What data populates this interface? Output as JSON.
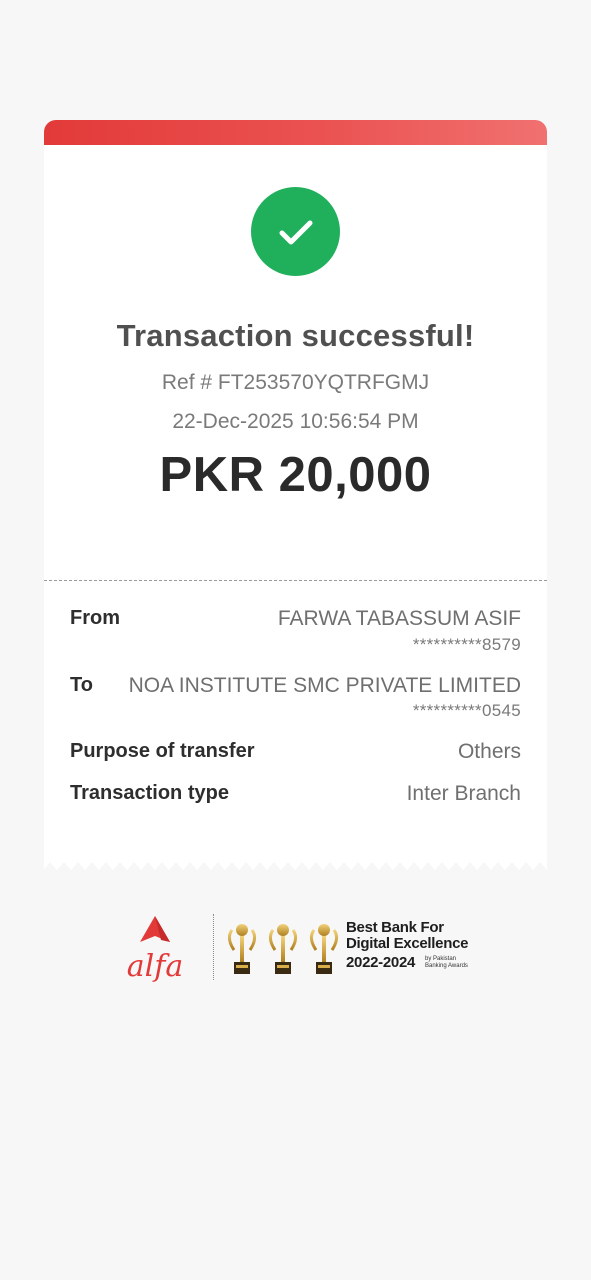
{
  "receipt": {
    "status_icon": "check-icon",
    "title": "Transaction successful!",
    "reference": "Ref # FT253570YQTRFGMJ",
    "datetime": "22-Dec-2025 10:56:54 PM",
    "amount": "PKR 20,000",
    "accent_color": "#e23a39",
    "success_color": "#20b05c"
  },
  "details": {
    "from": {
      "label": "From",
      "name": "FARWA TABASSUM ASIF",
      "account": "**********8579"
    },
    "to": {
      "label": "To",
      "name": "NOA INSTITUTE SMC PRIVATE LIMITED",
      "account": "**********0545"
    },
    "purpose": {
      "label": "Purpose of transfer",
      "value": "Others"
    },
    "type": {
      "label": "Transaction type",
      "value": "Inter Branch"
    }
  },
  "footer": {
    "logo_text": "alfa",
    "logo_icon": "alfa-logo-icon",
    "trophy_icon": "trophy-icon",
    "award_line1": "Best Bank For",
    "award_line2": "Digital Excellence",
    "award_years": "2022-2024",
    "award_source_line1": "by Pakistan",
    "award_source_line2": "Banking Awards"
  }
}
